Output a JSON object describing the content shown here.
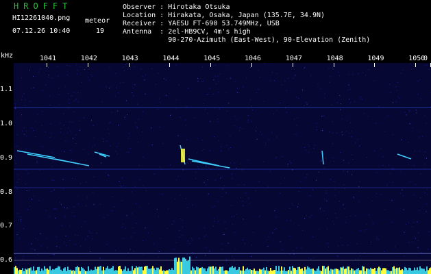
{
  "header": {
    "brand": "HROFFT",
    "file_name": "HI12261040.png",
    "meteor_label": "meteor",
    "datetime": "07.12.26 10:40",
    "meteor_count": "19",
    "observer": "Observer : Hirotaka Otsuka",
    "location": "Location : Hirakata, Osaka, Japan (135.7E, 34.9N)",
    "receiver": "Receiver : YAESU FT-690 53.749MHz, USB",
    "antenna": "Antenna  : 2el-HB9CV, 4m's high",
    "antenna_line2": "           90-270-Azimuth (East-West), 90-Elevation (Zenith)"
  },
  "axes": {
    "y_unit": "kHz",
    "y_ticks": [
      "1.1",
      "1.0",
      "0.9",
      "0.8",
      "0.7",
      "0.6"
    ],
    "x_ticks": [
      "1041",
      "1042",
      "1043",
      "1044",
      "1045",
      "1046",
      "1047",
      "1048",
      "1049",
      "1050",
      "0"
    ]
  },
  "colors": {
    "background": "#060733",
    "trace": "#3fd0ff",
    "trace_hot": "#ffff40",
    "header_brand": "#2fbf3f"
  }
}
